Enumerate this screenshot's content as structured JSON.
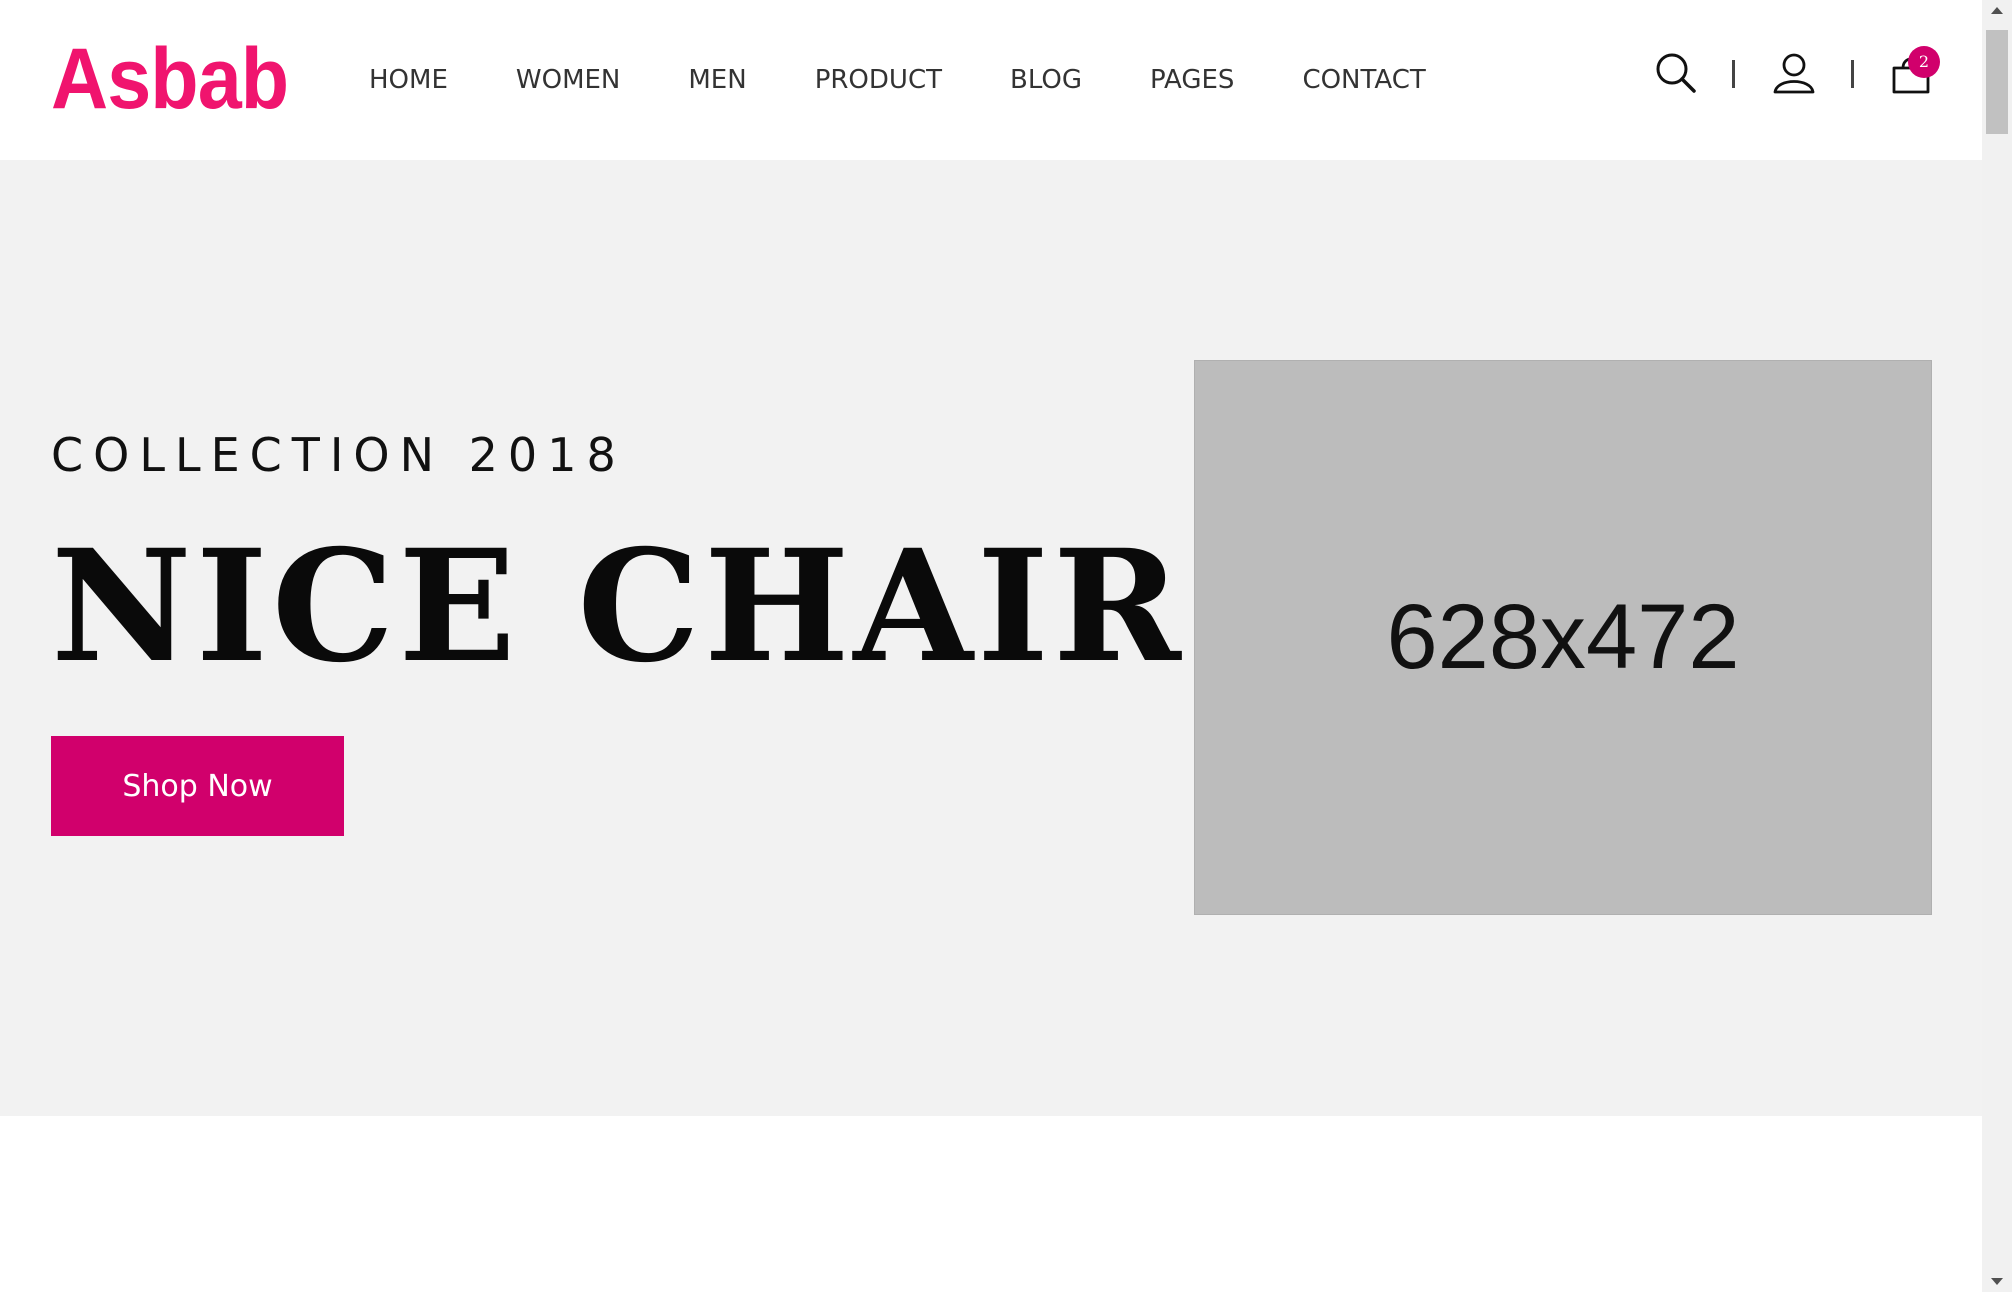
{
  "header": {
    "logo": "Asbab",
    "nav": [
      "HOME",
      "WOMEN",
      "MEN",
      "PRODUCT",
      "BLOG",
      "PAGES",
      "CONTACT"
    ],
    "cart_count": "2",
    "icons": [
      "search-icon",
      "user-icon",
      "shopping-bag-icon"
    ]
  },
  "hero": {
    "subtitle": "COLLECTION 2018",
    "title": "NICE CHAIR",
    "button": "Shop Now",
    "image_placeholder": "628x472"
  },
  "colors": {
    "accent": "#f0146e",
    "button": "#d1006c",
    "badge": "#d1006c",
    "hero_bg": "#f2f2f2",
    "placeholder_bg": "#bcbcbc"
  }
}
